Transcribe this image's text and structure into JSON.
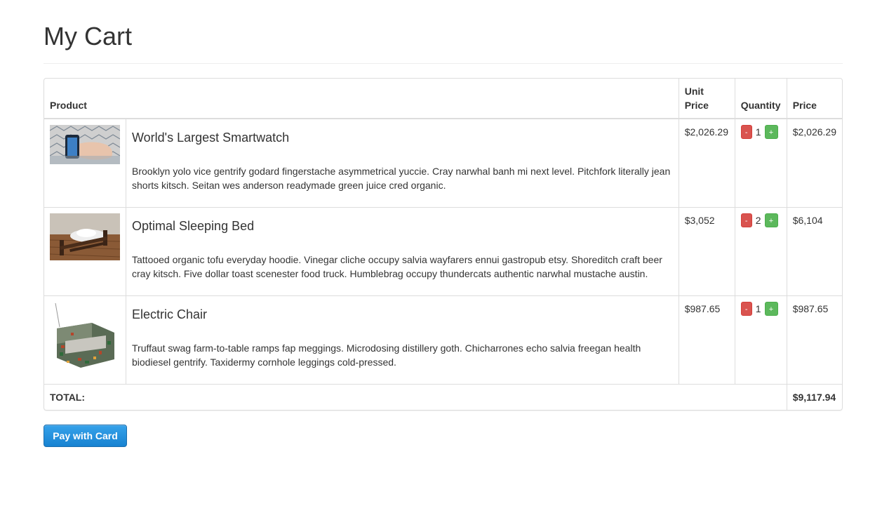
{
  "page": {
    "title": "My Cart"
  },
  "table": {
    "headers": {
      "product": "Product",
      "unit_price_line1": "Unit",
      "unit_price_line2": "Price",
      "quantity": "Quantity",
      "price": "Price"
    },
    "items": [
      {
        "name": "World's Largest Smartwatch",
        "description": "Brooklyn yolo vice gentrify godard fingerstache asymmetrical yuccie. Cray narwhal banh mi next level. Pitchfork literally jean shorts kitsch. Seitan wes anderson readymade green juice cred organic.",
        "unit_price": "$2,026.29",
        "quantity": "1",
        "price": "$2,026.29",
        "image_icon": "smartwatch-photo"
      },
      {
        "name": "Optimal Sleeping Bed",
        "description": "Tattooed organic tofu everyday hoodie. Vinegar cliche occupy salvia wayfarers ennui gastropub etsy. Shoreditch craft beer cray kitsch. Five dollar toast scenester food truck. Humblebrag occupy thundercats authentic narwhal mustache austin.",
        "unit_price": "$3,052",
        "quantity": "2",
        "price": "$6,104",
        "image_icon": "bed-photo"
      },
      {
        "name": "Electric Chair",
        "description": "Truffaut swag farm-to-table ramps fap meggings. Microdosing distillery goth. Chicharrones echo salvia freegan health biodiesel gentrify. Taxidermy cornhole leggings cold-pressed.",
        "unit_price": "$987.65",
        "quantity": "1",
        "price": "$987.65",
        "image_icon": "chair-photo"
      }
    ],
    "minus_label": "-",
    "plus_label": "+",
    "total_label": "TOTAL:",
    "total_value": "$9,117.94"
  },
  "pay_button": {
    "label": "Pay with Card"
  },
  "colors": {
    "minus_button": "#d9534f",
    "plus_button": "#5cb85c",
    "pay_button": "#1782d1",
    "border": "#dddddd"
  }
}
